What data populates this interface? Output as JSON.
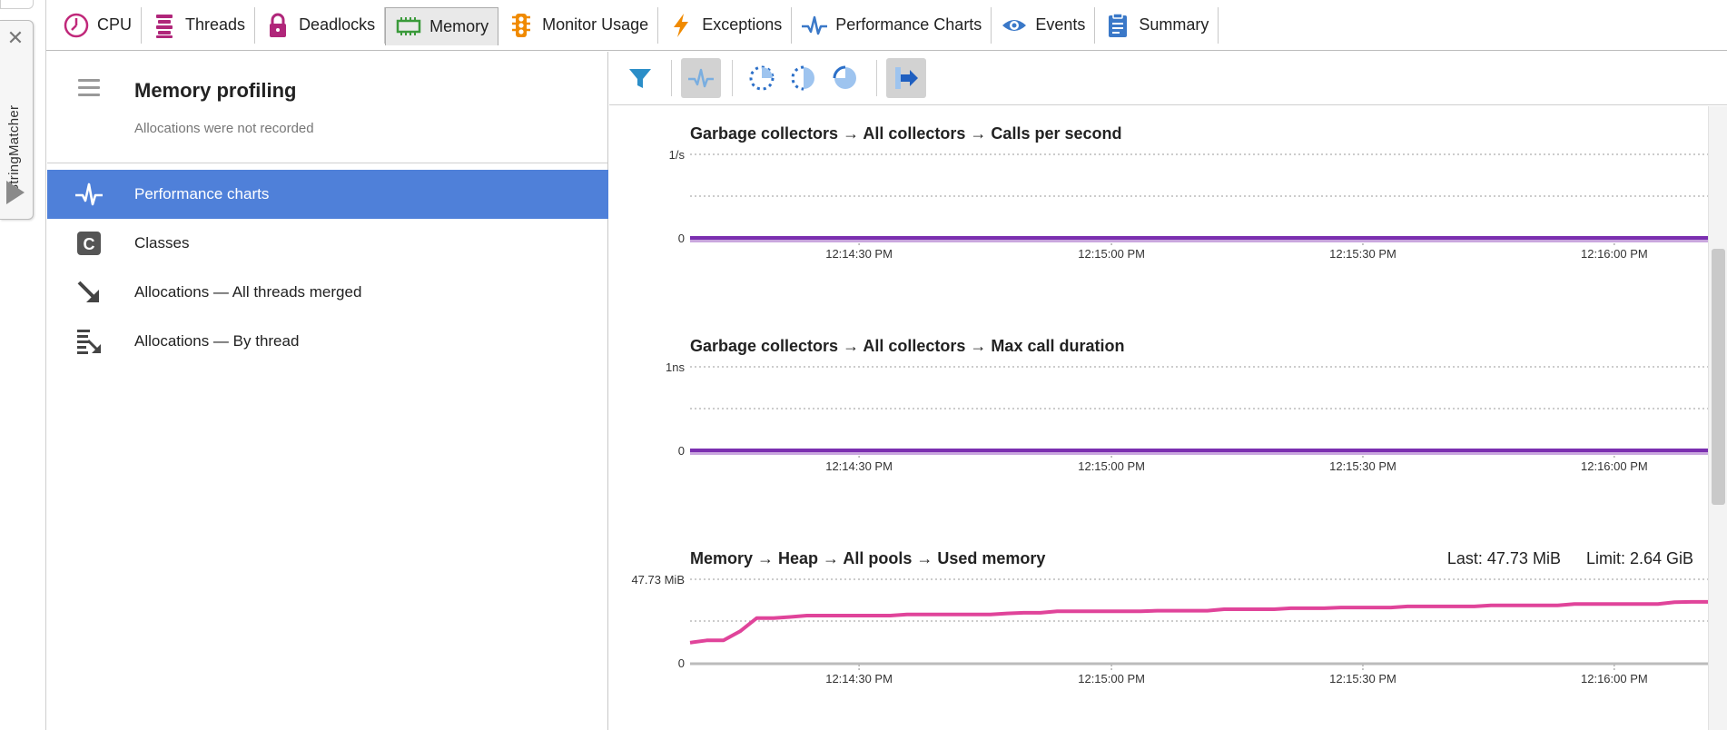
{
  "runner": {
    "close_glyph": "✕",
    "label": "StringMatcher"
  },
  "tabs": [
    {
      "label": "CPU",
      "icon": "clock-icon",
      "active": false
    },
    {
      "label": "Threads",
      "icon": "threads-icon",
      "active": false
    },
    {
      "label": "Deadlocks",
      "icon": "lock-icon",
      "active": false
    },
    {
      "label": "Memory",
      "icon": "memory-chip-icon",
      "active": true
    },
    {
      "label": "Monitor Usage",
      "icon": "traffic-light-icon",
      "active": false
    },
    {
      "label": "Exceptions",
      "icon": "lightning-icon",
      "active": false
    },
    {
      "label": "Performance Charts",
      "icon": "pulse-icon",
      "active": false
    },
    {
      "label": "Events",
      "icon": "eye-icon",
      "active": false
    },
    {
      "label": "Summary",
      "icon": "clipboard-icon",
      "active": false
    }
  ],
  "left_panel": {
    "title": "Memory profiling",
    "subtitle": "Allocations were not recorded",
    "items": [
      {
        "label": "Performance charts",
        "icon": "pulse-icon",
        "active": true
      },
      {
        "label": "Classes",
        "icon": "class-c-icon",
        "active": false
      },
      {
        "label": "Allocations — All threads merged",
        "icon": "arrow-down-right-icon",
        "active": false
      },
      {
        "label": "Allocations — By thread",
        "icon": "stack-arrow-icon",
        "active": false
      }
    ]
  },
  "toolbar": {
    "buttons": [
      {
        "name": "filter-button",
        "icon": "filter-icon",
        "pressed": false
      },
      {
        "name": "charts-toggle-button",
        "icon": "pulse-icon",
        "pressed": true
      },
      {
        "name": "pie-quarter-button",
        "icon": "pie-dashed-icon",
        "pressed": false
      },
      {
        "name": "pie-half-button",
        "icon": "pie-half-icon",
        "pressed": false
      },
      {
        "name": "pie-full-button",
        "icon": "pie-three-quarter-icon",
        "pressed": false
      },
      {
        "name": "export-button",
        "icon": "export-icon",
        "pressed": true
      }
    ]
  },
  "colors": {
    "accent": "#4f80d9",
    "gc_line": "#7b2fb0",
    "gc_line_shadow": "#c9a6de",
    "memory_line": "#e0449a",
    "grid": "#999999"
  },
  "chart_data": [
    {
      "type": "line",
      "title": "Garbage collectors → All collectors → Calls per second",
      "y_top_label": "1/s",
      "y_bottom_label": "0",
      "x_ticks": [
        "12:14:30 PM",
        "12:15:00 PM",
        "12:15:30 PM",
        "12:16:00 PM"
      ],
      "series": [
        {
          "values": [
            0,
            0,
            0,
            0,
            0,
            0,
            0,
            0,
            0,
            0,
            0,
            0
          ]
        }
      ],
      "ylim": [
        0,
        1
      ]
    },
    {
      "type": "line",
      "title": "Garbage collectors → All collectors → Max call duration",
      "y_top_label": "1ns",
      "y_bottom_label": "0",
      "x_ticks": [
        "12:14:30 PM",
        "12:15:00 PM",
        "12:15:30 PM",
        "12:16:00 PM"
      ],
      "series": [
        {
          "values": [
            0,
            0,
            0,
            0,
            0,
            0,
            0,
            0,
            0,
            0,
            0,
            0
          ]
        }
      ],
      "ylim": [
        0,
        1
      ]
    },
    {
      "type": "line",
      "title": "Memory → Heap → All pools → Used memory",
      "last_label": "Last: 47.73 MiB",
      "limit_label": "Limit: 2.64 GiB",
      "y_top_label": "47.73 MiB",
      "y_bottom_label": "0",
      "x_ticks": [
        "12:14:30 PM",
        "12:15:00 PM",
        "12:15:30 PM",
        "12:16:00 PM"
      ],
      "series": [
        {
          "values": [
            11.5,
            12.8,
            12.8,
            18.0,
            25.6,
            25.6,
            26.2,
            27.0,
            27.0,
            27.0,
            27.0,
            27.0,
            27.0,
            27.6,
            27.6,
            27.6,
            27.6,
            27.6,
            27.6,
            28.2,
            28.6,
            28.6,
            29.4,
            29.4,
            29.4,
            29.4,
            29.4,
            29.4,
            29.8,
            29.8,
            29.8,
            29.8,
            30.6,
            30.6,
            30.6,
            30.6,
            31.2,
            31.2,
            31.2,
            31.6,
            31.6,
            31.6,
            31.6,
            32.2,
            32.2,
            32.2,
            32.2,
            32.2,
            32.8,
            32.8,
            32.8,
            32.8,
            32.8,
            33.6,
            33.6,
            33.6,
            33.6,
            33.6,
            33.6,
            34.6,
            34.8,
            34.8
          ]
        }
      ],
      "ylim": [
        0,
        47.73
      ]
    }
  ]
}
